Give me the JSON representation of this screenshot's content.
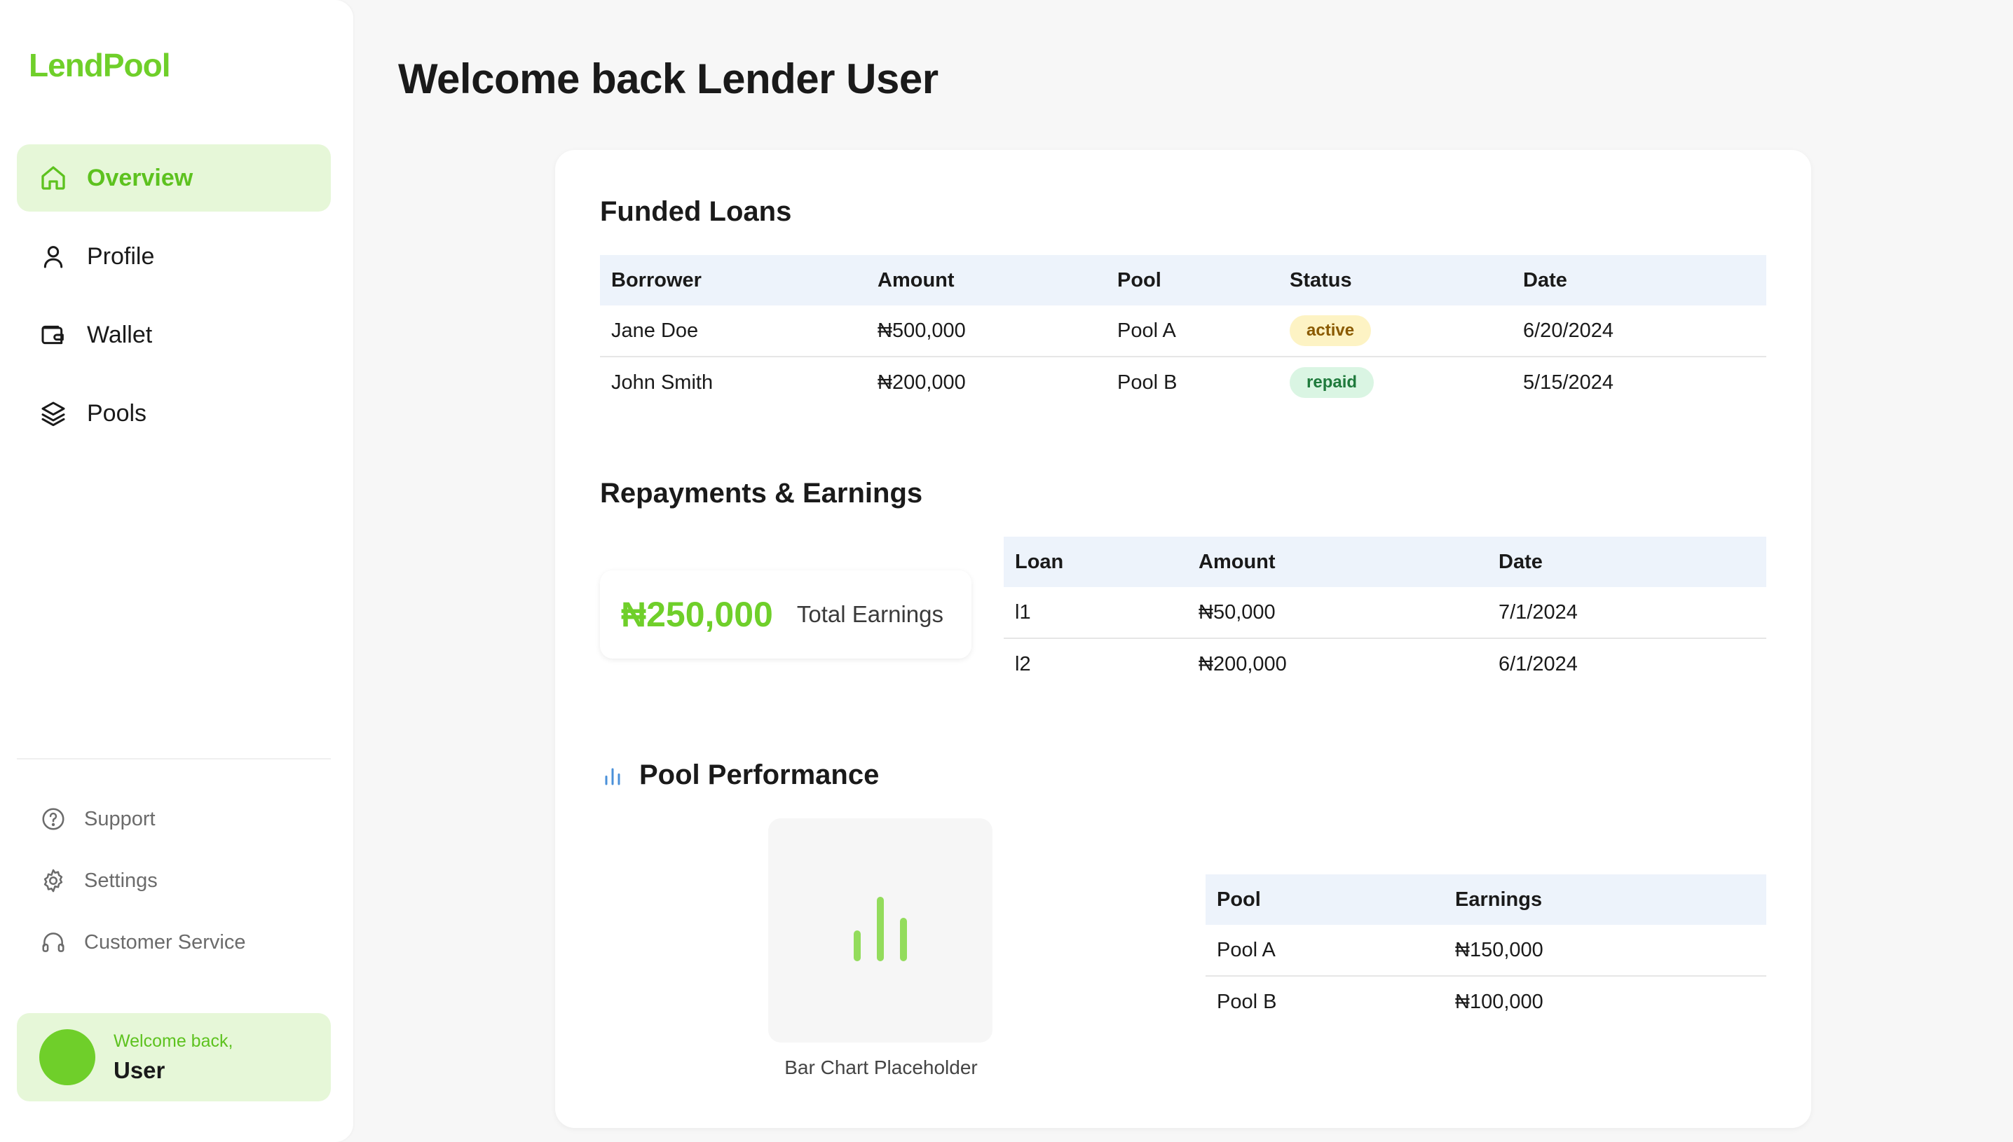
{
  "app": {
    "logo": "LendPool"
  },
  "sidebar": {
    "nav": [
      {
        "label": "Overview",
        "icon": "home-icon",
        "active": true
      },
      {
        "label": "Profile",
        "icon": "user-icon",
        "active": false
      },
      {
        "label": "Wallet",
        "icon": "wallet-icon",
        "active": false
      },
      {
        "label": "Pools",
        "icon": "layers-icon",
        "active": false
      }
    ],
    "secondary": [
      {
        "label": "Support",
        "icon": "help-circle-icon"
      },
      {
        "label": "Settings",
        "icon": "gear-icon"
      },
      {
        "label": "Customer Service",
        "icon": "headphones-icon"
      }
    ],
    "user": {
      "greeting": "Welcome back,",
      "name": "User"
    }
  },
  "main": {
    "title": "Welcome back Lender User",
    "funded_loans": {
      "title": "Funded Loans",
      "headers": [
        "Borrower",
        "Amount",
        "Pool",
        "Status",
        "Date"
      ],
      "rows": [
        {
          "borrower": "Jane Doe",
          "amount": "₦500,000",
          "pool": "Pool A",
          "status": "active",
          "date": "6/20/2024"
        },
        {
          "borrower": "John Smith",
          "amount": "₦200,000",
          "pool": "Pool B",
          "status": "repaid",
          "date": "5/15/2024"
        }
      ]
    },
    "repayments": {
      "title": "Repayments & Earnings",
      "total_value": "₦250,000",
      "total_label": "Total Earnings",
      "headers": [
        "Loan",
        "Amount",
        "Date"
      ],
      "rows": [
        {
          "loan": "l1",
          "amount": "₦50,000",
          "date": "7/1/2024"
        },
        {
          "loan": "l2",
          "amount": "₦200,000",
          "date": "6/1/2024"
        }
      ]
    },
    "pool_performance": {
      "title": "Pool Performance",
      "chart_caption": "Bar Chart Placeholder",
      "headers": [
        "Pool",
        "Earnings"
      ],
      "rows": [
        {
          "pool": "Pool A",
          "earnings": "₦150,000"
        },
        {
          "pool": "Pool B",
          "earnings": "₦100,000"
        }
      ]
    }
  },
  "colors": {
    "accent": "#6fcf2a",
    "accent_bg": "#e6f7d8",
    "table_header_bg": "#edf3fb",
    "badge_active_bg": "#fdf3c4",
    "badge_repaid_bg": "#daf5e3",
    "chart_icon": "#4a90d9"
  }
}
